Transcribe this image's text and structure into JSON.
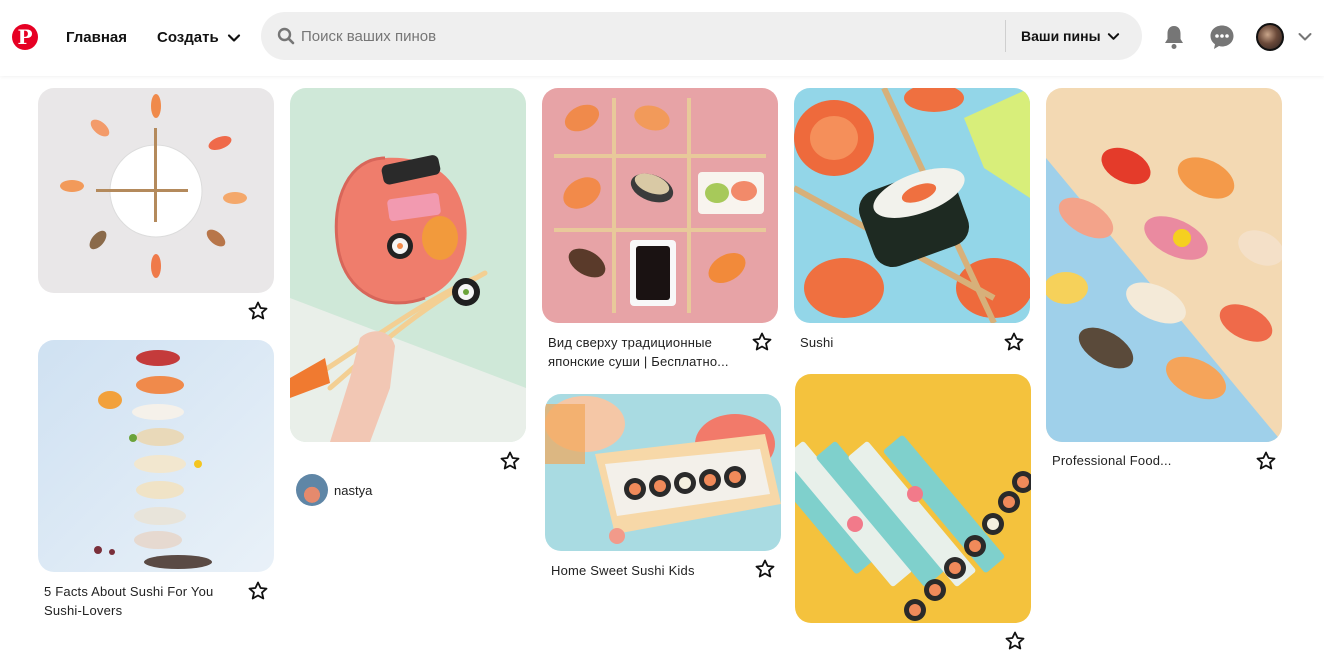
{
  "header": {
    "logo_letter": "P",
    "nav_home": "Главная",
    "nav_create": "Создать",
    "search_placeholder": "Поиск ваших пинов",
    "search_scope": "Ваши пины",
    "icons": [
      "pinterest-logo",
      "chevron-down-icon",
      "search-icon",
      "bell-icon",
      "chat-icon",
      "avatar",
      "chevron-down-icon"
    ]
  },
  "pins": {
    "clock": {
      "title": ""
    },
    "chop": {
      "title": "",
      "creator": "nastya"
    },
    "tictac": {
      "title_line1": "Вид сверху традиционные",
      "title_line2": "японские суши | Бесплатно..."
    },
    "roll": {
      "title": "Sushi"
    },
    "nigiri": {
      "title": "Professional Food..."
    },
    "facts": {
      "title_line1": "5 Facts About Sushi For You",
      "title_line2": "Sushi-Lovers"
    },
    "box": {
      "title": "Home Sweet Sushi Kids"
    },
    "yellow": {
      "title": ""
    }
  },
  "colors": {
    "brand": "#e60023",
    "search_bg": "#efefef"
  }
}
